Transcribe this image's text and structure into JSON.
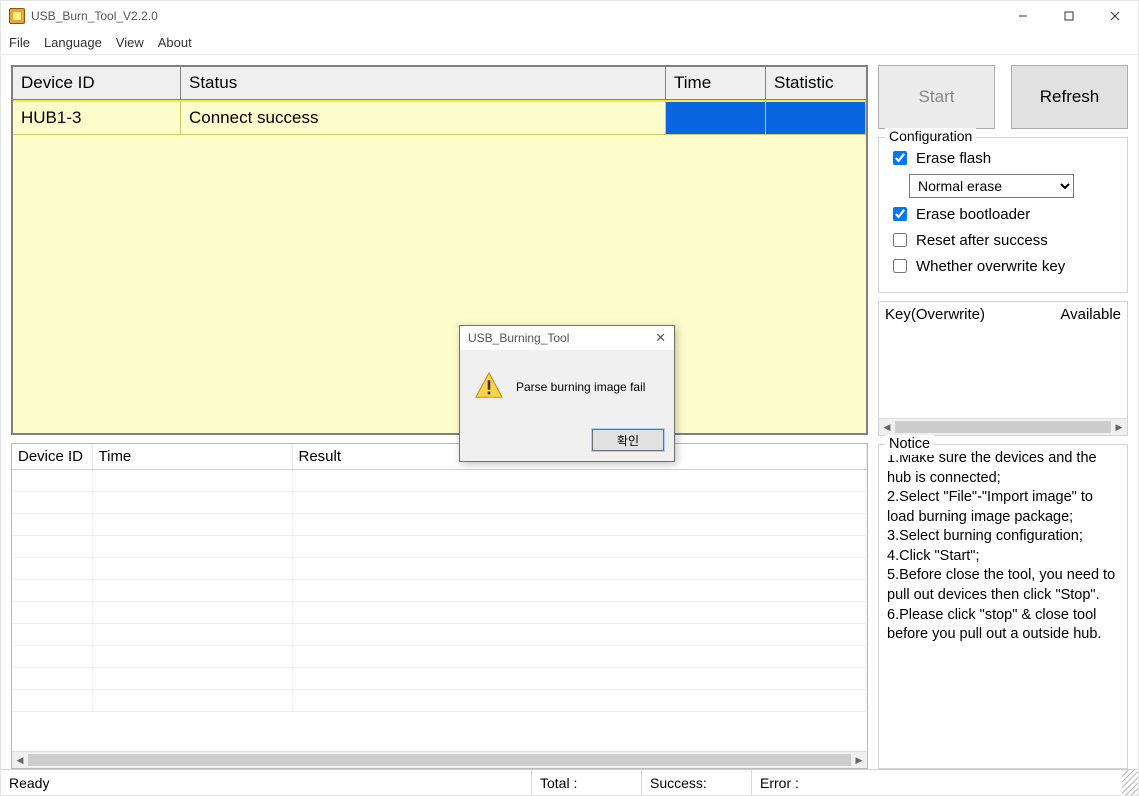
{
  "window": {
    "title": "USB_Burn_Tool_V2.2.0"
  },
  "menu": {
    "file": "File",
    "language": "Language",
    "view": "View",
    "about": "About"
  },
  "dev_table": {
    "headers": {
      "device_id": "Device ID",
      "status": "Status",
      "time": "Time",
      "statistic": "Statistic"
    },
    "rows": [
      {
        "device_id": "HUB1-3",
        "status": "Connect success",
        "time": "",
        "statistic": ""
      }
    ]
  },
  "res_table": {
    "headers": {
      "device_id": "Device ID",
      "time": "Time",
      "result": "Result"
    }
  },
  "buttons": {
    "start": "Start",
    "refresh": "Refresh"
  },
  "config": {
    "legend": "Configuration",
    "erase_flash": {
      "label": "Erase flash",
      "checked": true
    },
    "erase_mode": "Normal erase",
    "erase_bootloader": {
      "label": "Erase bootloader",
      "checked": true
    },
    "reset_after": {
      "label": "Reset after success",
      "checked": false
    },
    "overwrite_key": {
      "label": "Whether overwrite key",
      "checked": false
    }
  },
  "key_box": {
    "col1": "Key(Overwrite)",
    "col2": "Available"
  },
  "notice": {
    "legend": "Notice",
    "lines": [
      "1.Make sure the devices and the hub is connected;",
      "2.Select \"File\"-\"Import image\" to load burning image package;",
      "3.Select burning configuration;",
      "4.Click \"Start\";",
      "5.Before close the tool, you need to pull out devices then click \"Stop\".",
      "6.Please click \"stop\" & close tool before you pull out a outside hub."
    ]
  },
  "statusbar": {
    "ready": "Ready",
    "total": "Total :",
    "success": "Success:",
    "error": "Error :"
  },
  "dialog": {
    "title": "USB_Burning_Tool",
    "message": "Parse burning image fail",
    "ok": "확인"
  }
}
